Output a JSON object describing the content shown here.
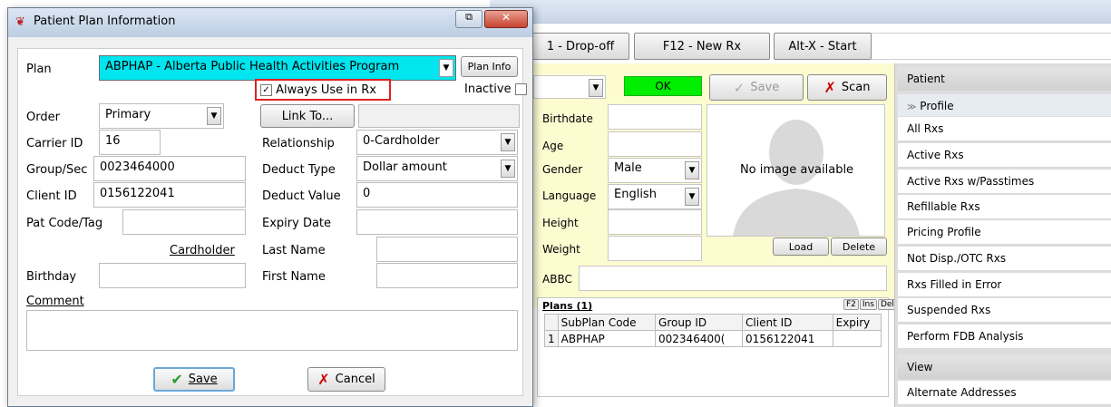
{
  "toolbar": {
    "dropoff": "1 - Drop-off",
    "new_rx": "F12 - New Rx",
    "start": "Alt-X - Start"
  },
  "status": {
    "ok": "OK",
    "save": "Save",
    "scan": "Scan",
    "ok_color": "#00ee00"
  },
  "patient_fields": {
    "birthdate_label": "Birthdate",
    "age_label": "Age",
    "gender_label": "Gender",
    "gender_value": "Male",
    "language_label": "Language",
    "language_value": "English",
    "height_label": "Height",
    "weight_label": "Weight",
    "abbc_label": "ABBC"
  },
  "photo": {
    "no_image": "No image available",
    "load": "Load",
    "delete": "Delete"
  },
  "plans_grid": {
    "title": "Plans (1)",
    "keys": [
      "F2",
      "Ins",
      "Del"
    ],
    "headers": [
      "SubPlan Code",
      "Group ID",
      "Client ID",
      "Expiry"
    ],
    "rows": [
      {
        "num": "1",
        "subplan": "ABPHAP",
        "group": "002346400(",
        "client": "0156122041",
        "expiry": ""
      }
    ]
  },
  "sidebar": {
    "patient_header": "Patient",
    "profile_header": "Profile",
    "items": [
      "All Rxs",
      "Active Rxs",
      "Active Rxs w/Passtimes",
      "Refillable Rxs",
      "Pricing Profile",
      "Not Disp./OTC Rxs",
      "Rxs Filled in Error",
      "Suspended Rxs",
      "Perform FDB Analysis"
    ],
    "view_header": "View",
    "view_items": [
      "Alternate Addresses"
    ]
  },
  "dialog": {
    "title": "Patient Plan Information",
    "plan_label": "Plan",
    "plan_value": "ABPHAP - Alberta Public Health Activities Program",
    "plan_info": "Plan Info",
    "always_use": "Always Use in Rx",
    "inactive": "Inactive",
    "order_label": "Order",
    "order_value": "Primary",
    "link_to": "Link To...",
    "carrier_label": "Carrier ID",
    "carrier_value": "16",
    "relationship_label": "Relationship",
    "relationship_value": "0-Cardholder",
    "group_label": "Group/Sec",
    "group_value": "0023464000",
    "deduct_type_label": "Deduct Type",
    "deduct_type_value": "Dollar amount",
    "client_label": "Client ID",
    "client_value": "0156122041",
    "deduct_value_label": "Deduct Value",
    "deduct_value_value": "0",
    "patcode_label": "Pat Code/Tag",
    "expiry_label": "Expiry Date",
    "cardholder_label": "Cardholder",
    "last_name_label": "Last Name",
    "birthday_label": "Birthday",
    "first_name_label": "First Name",
    "comment_label": "Comment",
    "save": "Save",
    "cancel": "Cancel",
    "highlight_color": "#00e5ee",
    "callout_color": "#e02020"
  }
}
